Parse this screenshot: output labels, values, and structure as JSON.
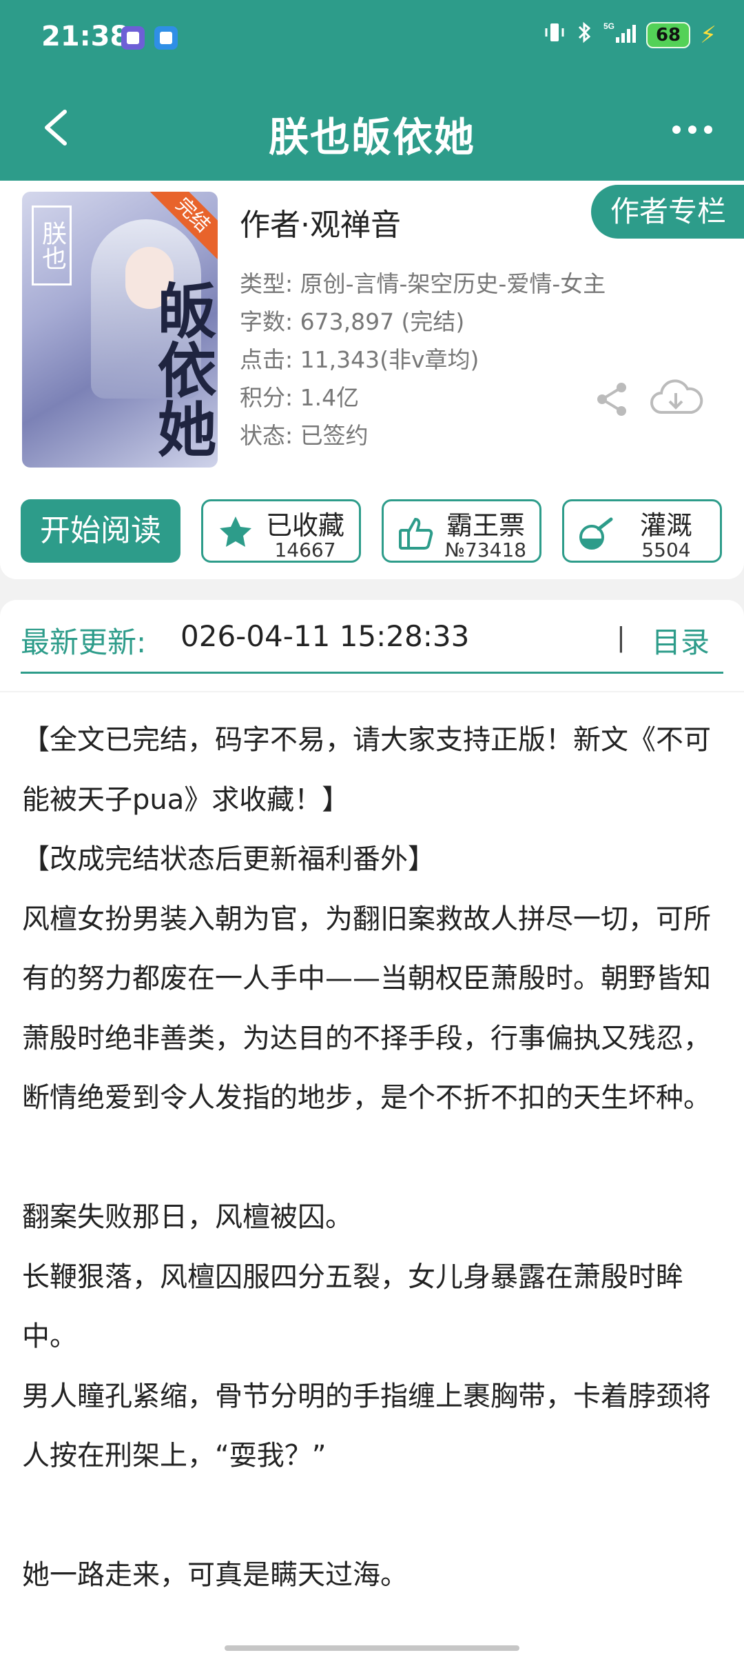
{
  "status_bar": {
    "time": "21:38",
    "battery": "68",
    "signal": "5G",
    "icons": [
      "hourglass-icon",
      "wallet-icon",
      "vibrate-icon",
      "bluetooth-icon",
      "signal-icon",
      "charging-icon"
    ]
  },
  "nav": {
    "title": "朕也皈依她",
    "back_icon": "chevron-left-icon",
    "more_icon": "more-horizontal-icon"
  },
  "book": {
    "cover_label_top": "朕也",
    "cover_title_big": "皈依她",
    "cover_badge": "完结",
    "author": "作者·观禅音",
    "author_column_button": "作者专栏",
    "meta": [
      "类型: 原创-言情-架空历史-爱情-女主",
      "字数: 673,897 (完结)",
      "点击: 11,343(非v章均)",
      "积分: 1.4亿",
      "状态: 已签约"
    ]
  },
  "actions": {
    "read": "开始阅读",
    "favorite": {
      "label": "已收藏",
      "count": "14667",
      "icon": "star-icon"
    },
    "vote": {
      "label": "霸王票",
      "count": "№73418",
      "icon": "thumbs-up-icon"
    },
    "water": {
      "label": "灌溉",
      "count": "5504",
      "icon": "watering-flask-icon"
    }
  },
  "update": {
    "label": "最新更新:",
    "value": "026-04-11 15:28:33",
    "separator": "|",
    "toc": "目录"
  },
  "description": [
    "【全文已完结，码字不易，请大家支持正版！新文《不可能被天子pua》求收藏！】",
    "【改成完结状态后更新福利番外】",
    "风檀女扮男装入朝为官，为翻旧案救故人拼尽一切，可所有的努力都废在一人手中——当朝权臣萧殷时。朝野皆知萧殷时绝非善类，为达目的不择手段，行事偏执又残忍，断情绝爱到令人发指的地步，是个不折不扣的天生坏种。",
    "",
    "翻案失败那日，风檀被囚。",
    "长鞭狠落，风檀囚服四分五裂，女儿身暴露在萧殷时眸中。",
    "男人瞳孔紧缩，骨节分明的手指缠上裹胸带，卡着脖颈将人按在刑架上，“耍我？”",
    "",
    "她一路走来，可真是瞒天过海。"
  ],
  "colors": {
    "primary": "#2d9c8a",
    "badge_orange": "#e8632b",
    "battery_green": "#53d157"
  }
}
